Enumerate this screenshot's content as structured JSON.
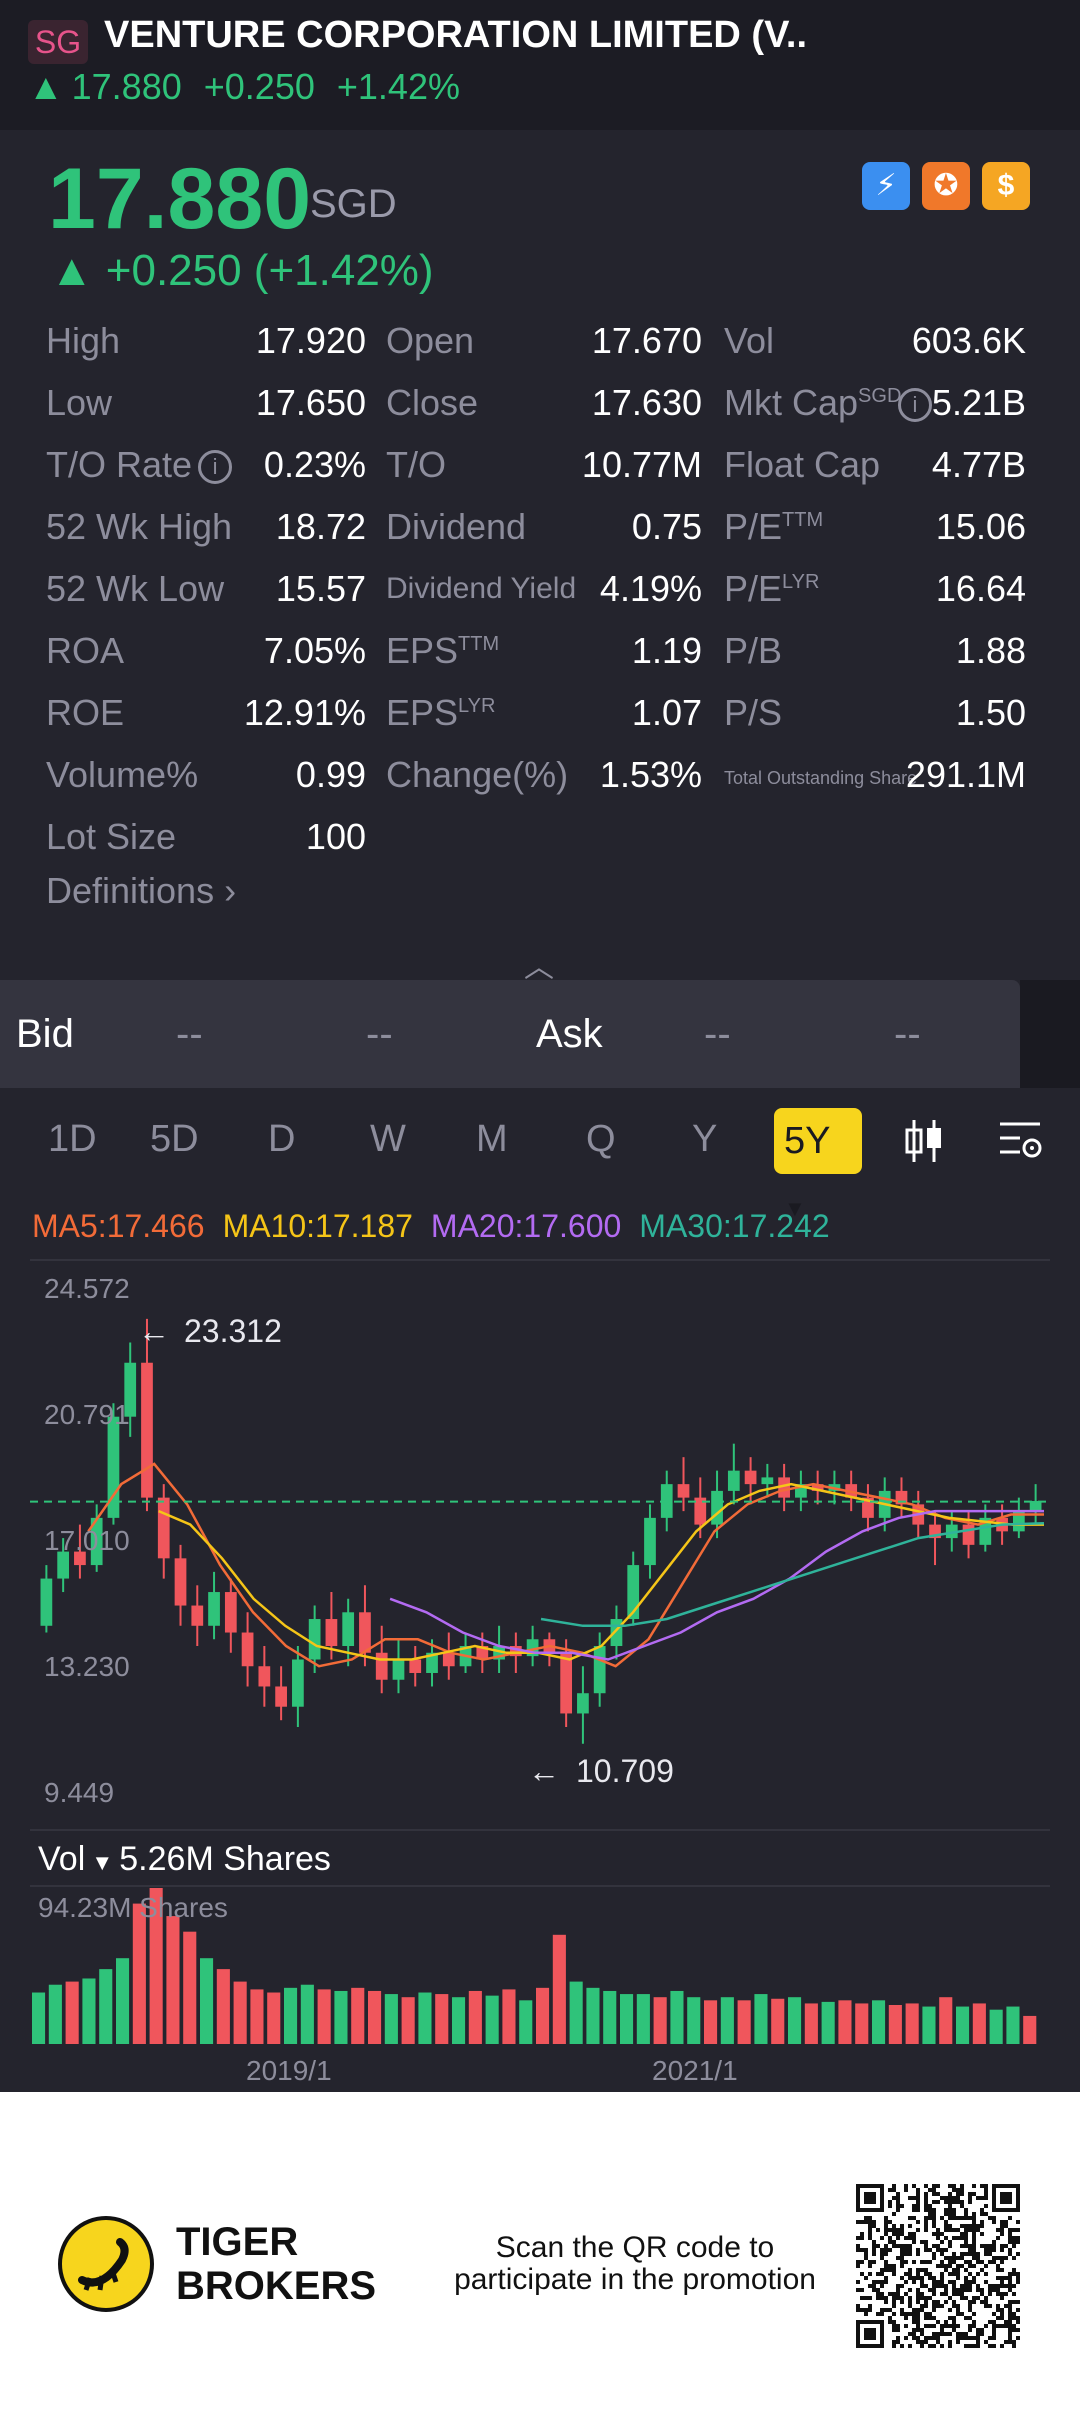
{
  "header": {
    "market_badge": "SG",
    "title": "VENTURE CORPORATION LIMITED (V..",
    "last": "17.880",
    "change": "+0.250",
    "change_pct": "+1.42%"
  },
  "quote": {
    "price": "17.880",
    "currency": "SGD",
    "change_line": "+0.250 (+1.42%)",
    "badges": [
      {
        "icon": "lightning-icon",
        "color": "#3b8ff0",
        "text": "⚡"
      },
      {
        "icon": "tiger-icon",
        "color": "#f0782a",
        "text": "✪"
      },
      {
        "icon": "dollar-icon",
        "color": "#f5a623",
        "text": "$"
      }
    ]
  },
  "stats": {
    "high_label": "High",
    "high": "17.920",
    "open_label": "Open",
    "open": "17.670",
    "vol_label": "Vol",
    "vol": "603.6K",
    "low_label": "Low",
    "low": "17.650",
    "close_label": "Close",
    "close": "17.630",
    "mktcap_label": "Mkt Cap",
    "mktcap_sup": "SGD",
    "mktcap": "5.21B",
    "to_rate_label": "T/O Rate",
    "to_rate": "0.23%",
    "to_label": "T/O",
    "to": "10.77M",
    "float_label": "Float Cap",
    "float": "4.77B",
    "wk52h_label": "52 Wk High",
    "wk52h": "18.72",
    "div_label": "Dividend",
    "div": "0.75",
    "pe_ttm_label": "P/E",
    "pe_ttm_sup": "TTM",
    "pe_ttm": "15.06",
    "wk52l_label": "52 Wk Low",
    "wk52l": "15.57",
    "divy_label": "Dividend Yield",
    "divy": "4.19%",
    "pe_lyr_label": "P/E",
    "pe_lyr_sup": "LYR",
    "pe_lyr": "16.64",
    "roa_label": "ROA",
    "roa": "7.05%",
    "eps_ttm_label": "EPS",
    "eps_ttm_sup": "TTM",
    "eps_ttm": "1.19",
    "pb_label": "P/B",
    "pb": "1.88",
    "roe_label": "ROE",
    "roe": "12.91%",
    "eps_lyr_label": "EPS",
    "eps_lyr_sup": "LYR",
    "eps_lyr": "1.07",
    "ps_label": "P/S",
    "ps": "1.50",
    "volpct_label": "Volume%",
    "volpct": "0.99",
    "chg_label": "Change(%)",
    "chg": "1.53%",
    "tos_label": "Total Outstanding Share",
    "tos": "291.1M",
    "lot_label": "Lot Size",
    "lot": "100",
    "definitions": "Definitions"
  },
  "bidask": {
    "bid_label": "Bid",
    "bid_price": "--",
    "bid_size": "--",
    "ask_label": "Ask",
    "ask_price": "--",
    "ask_size": "--"
  },
  "tabs": {
    "items": [
      "1D",
      "5D",
      "D",
      "W",
      "M",
      "Q",
      "Y"
    ],
    "active": "5Y"
  },
  "ma": {
    "ma5": "MA5:17.466",
    "ma10": "MA10:17.187",
    "ma20": "MA20:17.600",
    "ma30": "MA30:17.242",
    "colors": {
      "ma5": "#f26b38",
      "ma10": "#f5c518",
      "ma20": "#b36bf2",
      "ma30": "#2fb39a"
    }
  },
  "volume": {
    "label": "Vol",
    "value": "5.26M Shares",
    "max": "94.23M Shares"
  },
  "chart_data": {
    "type": "candlestick",
    "y_ticks": [
      "24.572",
      "20.791",
      "17.010",
      "13.230",
      "9.449"
    ],
    "ylim": [
      9.449,
      24.572
    ],
    "high_annotation": "23.312",
    "low_annotation": "10.709",
    "x_ticks": [
      "2019/1",
      "2021/1"
    ],
    "last_close": 17.88,
    "candles": [
      {
        "o": 14.2,
        "c": 15.6,
        "h": 16.0,
        "l": 14.0
      },
      {
        "o": 15.6,
        "c": 16.4,
        "h": 16.8,
        "l": 15.2
      },
      {
        "o": 16.4,
        "c": 16.0,
        "h": 17.2,
        "l": 15.6
      },
      {
        "o": 16.0,
        "c": 17.4,
        "h": 17.8,
        "l": 15.8
      },
      {
        "o": 17.4,
        "c": 20.4,
        "h": 20.8,
        "l": 17.2
      },
      {
        "o": 20.4,
        "c": 22.0,
        "h": 22.6,
        "l": 19.8
      },
      {
        "o": 22.0,
        "c": 18.0,
        "h": 23.3,
        "l": 17.6
      },
      {
        "o": 18.0,
        "c": 16.2,
        "h": 18.4,
        "l": 15.6
      },
      {
        "o": 16.2,
        "c": 14.8,
        "h": 16.6,
        "l": 14.2
      },
      {
        "o": 14.8,
        "c": 14.2,
        "h": 15.4,
        "l": 13.6
      },
      {
        "o": 14.2,
        "c": 15.2,
        "h": 15.8,
        "l": 13.8
      },
      {
        "o": 15.2,
        "c": 14.0,
        "h": 15.6,
        "l": 13.4
      },
      {
        "o": 14.0,
        "c": 13.0,
        "h": 14.6,
        "l": 12.4
      },
      {
        "o": 13.0,
        "c": 12.4,
        "h": 13.6,
        "l": 11.8
      },
      {
        "o": 12.4,
        "c": 11.8,
        "h": 13.0,
        "l": 11.4
      },
      {
        "o": 11.8,
        "c": 13.2,
        "h": 13.6,
        "l": 11.2
      },
      {
        "o": 13.2,
        "c": 14.4,
        "h": 14.8,
        "l": 12.8
      },
      {
        "o": 14.4,
        "c": 13.6,
        "h": 15.2,
        "l": 13.2
      },
      {
        "o": 13.6,
        "c": 14.6,
        "h": 15.0,
        "l": 13.0
      },
      {
        "o": 14.6,
        "c": 13.4,
        "h": 15.4,
        "l": 13.0
      },
      {
        "o": 13.4,
        "c": 12.6,
        "h": 14.2,
        "l": 12.2
      },
      {
        "o": 12.6,
        "c": 13.2,
        "h": 13.8,
        "l": 12.2
      },
      {
        "o": 13.2,
        "c": 12.8,
        "h": 13.6,
        "l": 12.4
      },
      {
        "o": 12.8,
        "c": 13.4,
        "h": 13.8,
        "l": 12.4
      },
      {
        "o": 13.4,
        "c": 13.0,
        "h": 14.0,
        "l": 12.6
      },
      {
        "o": 13.0,
        "c": 13.6,
        "h": 14.0,
        "l": 12.8
      },
      {
        "o": 13.6,
        "c": 13.2,
        "h": 14.0,
        "l": 12.8
      },
      {
        "o": 13.2,
        "c": 13.6,
        "h": 14.2,
        "l": 12.8
      },
      {
        "o": 13.6,
        "c": 13.3,
        "h": 14.0,
        "l": 12.8
      },
      {
        "o": 13.3,
        "c": 13.8,
        "h": 14.2,
        "l": 13.0
      },
      {
        "o": 13.8,
        "c": 13.4,
        "h": 14.0,
        "l": 13.0
      },
      {
        "o": 13.4,
        "c": 11.6,
        "h": 13.8,
        "l": 11.2
      },
      {
        "o": 11.6,
        "c": 12.2,
        "h": 13.0,
        "l": 10.7
      },
      {
        "o": 12.2,
        "c": 13.6,
        "h": 14.0,
        "l": 11.8
      },
      {
        "o": 13.6,
        "c": 14.4,
        "h": 14.8,
        "l": 13.2
      },
      {
        "o": 14.4,
        "c": 16.0,
        "h": 16.4,
        "l": 14.2
      },
      {
        "o": 16.0,
        "c": 17.4,
        "h": 17.8,
        "l": 15.6
      },
      {
        "o": 17.4,
        "c": 18.4,
        "h": 18.8,
        "l": 17.0
      },
      {
        "o": 18.4,
        "c": 18.0,
        "h": 19.2,
        "l": 17.6
      },
      {
        "o": 18.0,
        "c": 17.2,
        "h": 18.6,
        "l": 16.8
      },
      {
        "o": 17.2,
        "c": 18.2,
        "h": 18.8,
        "l": 16.8
      },
      {
        "o": 18.2,
        "c": 18.8,
        "h": 19.6,
        "l": 17.8
      },
      {
        "o": 18.8,
        "c": 18.4,
        "h": 19.2,
        "l": 17.8
      },
      {
        "o": 18.4,
        "c": 18.6,
        "h": 19.0,
        "l": 18.0
      },
      {
        "o": 18.6,
        "c": 18.0,
        "h": 19.0,
        "l": 17.6
      },
      {
        "o": 18.0,
        "c": 18.4,
        "h": 18.8,
        "l": 17.6
      },
      {
        "o": 18.4,
        "c": 18.2,
        "h": 18.8,
        "l": 17.8
      },
      {
        "o": 18.2,
        "c": 18.4,
        "h": 18.8,
        "l": 17.8
      },
      {
        "o": 18.4,
        "c": 18.0,
        "h": 18.8,
        "l": 17.6
      },
      {
        "o": 18.0,
        "c": 17.4,
        "h": 18.4,
        "l": 17.0
      },
      {
        "o": 17.4,
        "c": 18.2,
        "h": 18.6,
        "l": 17.0
      },
      {
        "o": 18.2,
        "c": 17.8,
        "h": 18.6,
        "l": 17.4
      },
      {
        "o": 17.8,
        "c": 17.2,
        "h": 18.2,
        "l": 16.8
      },
      {
        "o": 17.2,
        "c": 16.8,
        "h": 17.6,
        "l": 16.0
      },
      {
        "o": 16.8,
        "c": 17.2,
        "h": 17.6,
        "l": 16.4
      },
      {
        "o": 17.2,
        "c": 16.6,
        "h": 17.6,
        "l": 16.2
      },
      {
        "o": 16.6,
        "c": 17.4,
        "h": 17.8,
        "l": 16.4
      },
      {
        "o": 17.4,
        "c": 17.0,
        "h": 17.8,
        "l": 16.6
      },
      {
        "o": 17.0,
        "c": 17.6,
        "h": 18.0,
        "l": 16.8
      },
      {
        "o": 17.6,
        "c": 17.9,
        "h": 18.4,
        "l": 17.2
      }
    ],
    "ma_series": {
      "ma5": [
        17.0,
        18.4,
        19.0,
        17.8,
        16.0,
        14.6,
        13.6,
        13.0,
        13.2,
        13.8,
        13.8,
        13.4,
        13.2,
        13.4,
        13.6,
        13.4,
        13.0,
        13.8,
        15.4,
        17.0,
        17.8,
        18.2,
        18.4,
        18.2,
        18.0,
        17.8,
        17.4,
        17.2,
        17.5,
        17.5
      ],
      "ma10": [
        17.6,
        17.2,
        16.2,
        15.0,
        14.2,
        13.6,
        13.4,
        13.2,
        13.2,
        13.4,
        13.6,
        13.4,
        13.4,
        13.2,
        13.6,
        14.6,
        15.8,
        17.0,
        17.8,
        18.2,
        18.4,
        18.2,
        18.0,
        17.8,
        17.6,
        17.4,
        17.3,
        17.2,
        17.2
      ],
      "ma20": [
        15.0,
        14.6,
        14.0,
        13.6,
        13.4,
        13.4,
        13.2,
        13.6,
        14.0,
        14.6,
        15.0,
        15.6,
        16.4,
        17.0,
        17.4,
        17.6,
        17.6,
        17.6,
        17.6
      ],
      "ma30": [
        14.4,
        14.2,
        14.2,
        14.4,
        14.8,
        15.2,
        15.6,
        16.0,
        16.4,
        16.8,
        17.0,
        17.2,
        17.24
      ]
    },
    "volume_values": [
      33,
      38,
      40,
      42,
      48,
      55,
      90,
      100,
      82,
      72,
      55,
      48,
      40,
      35,
      33,
      36,
      38,
      35,
      34,
      36,
      34,
      32,
      30,
      33,
      32,
      30,
      34,
      31,
      35,
      28,
      36,
      70,
      40,
      36,
      34,
      32,
      32,
      30,
      34,
      30,
      28,
      30,
      28,
      32,
      29,
      30,
      26,
      27,
      28,
      26,
      28,
      25,
      26,
      24,
      30,
      24,
      26,
      22,
      24,
      18
    ],
    "volume_up": [
      1,
      1,
      0,
      1,
      1,
      1,
      0,
      0,
      0,
      0,
      1,
      0,
      0,
      0,
      0,
      1,
      1,
      0,
      1,
      0,
      0,
      1,
      0,
      1,
      0,
      1,
      0,
      1,
      0,
      1,
      0,
      0,
      1,
      1,
      1,
      1,
      1,
      0,
      1,
      1,
      0,
      1,
      0,
      1,
      0,
      1,
      0,
      1,
      0,
      0,
      1,
      0,
      0,
      1,
      0,
      1,
      0,
      1,
      1,
      0
    ]
  },
  "footer": {
    "brand_line1": "TIGER",
    "brand_line2": "BROKERS",
    "scan_text": "Scan the QR code to participate in the promotion"
  }
}
